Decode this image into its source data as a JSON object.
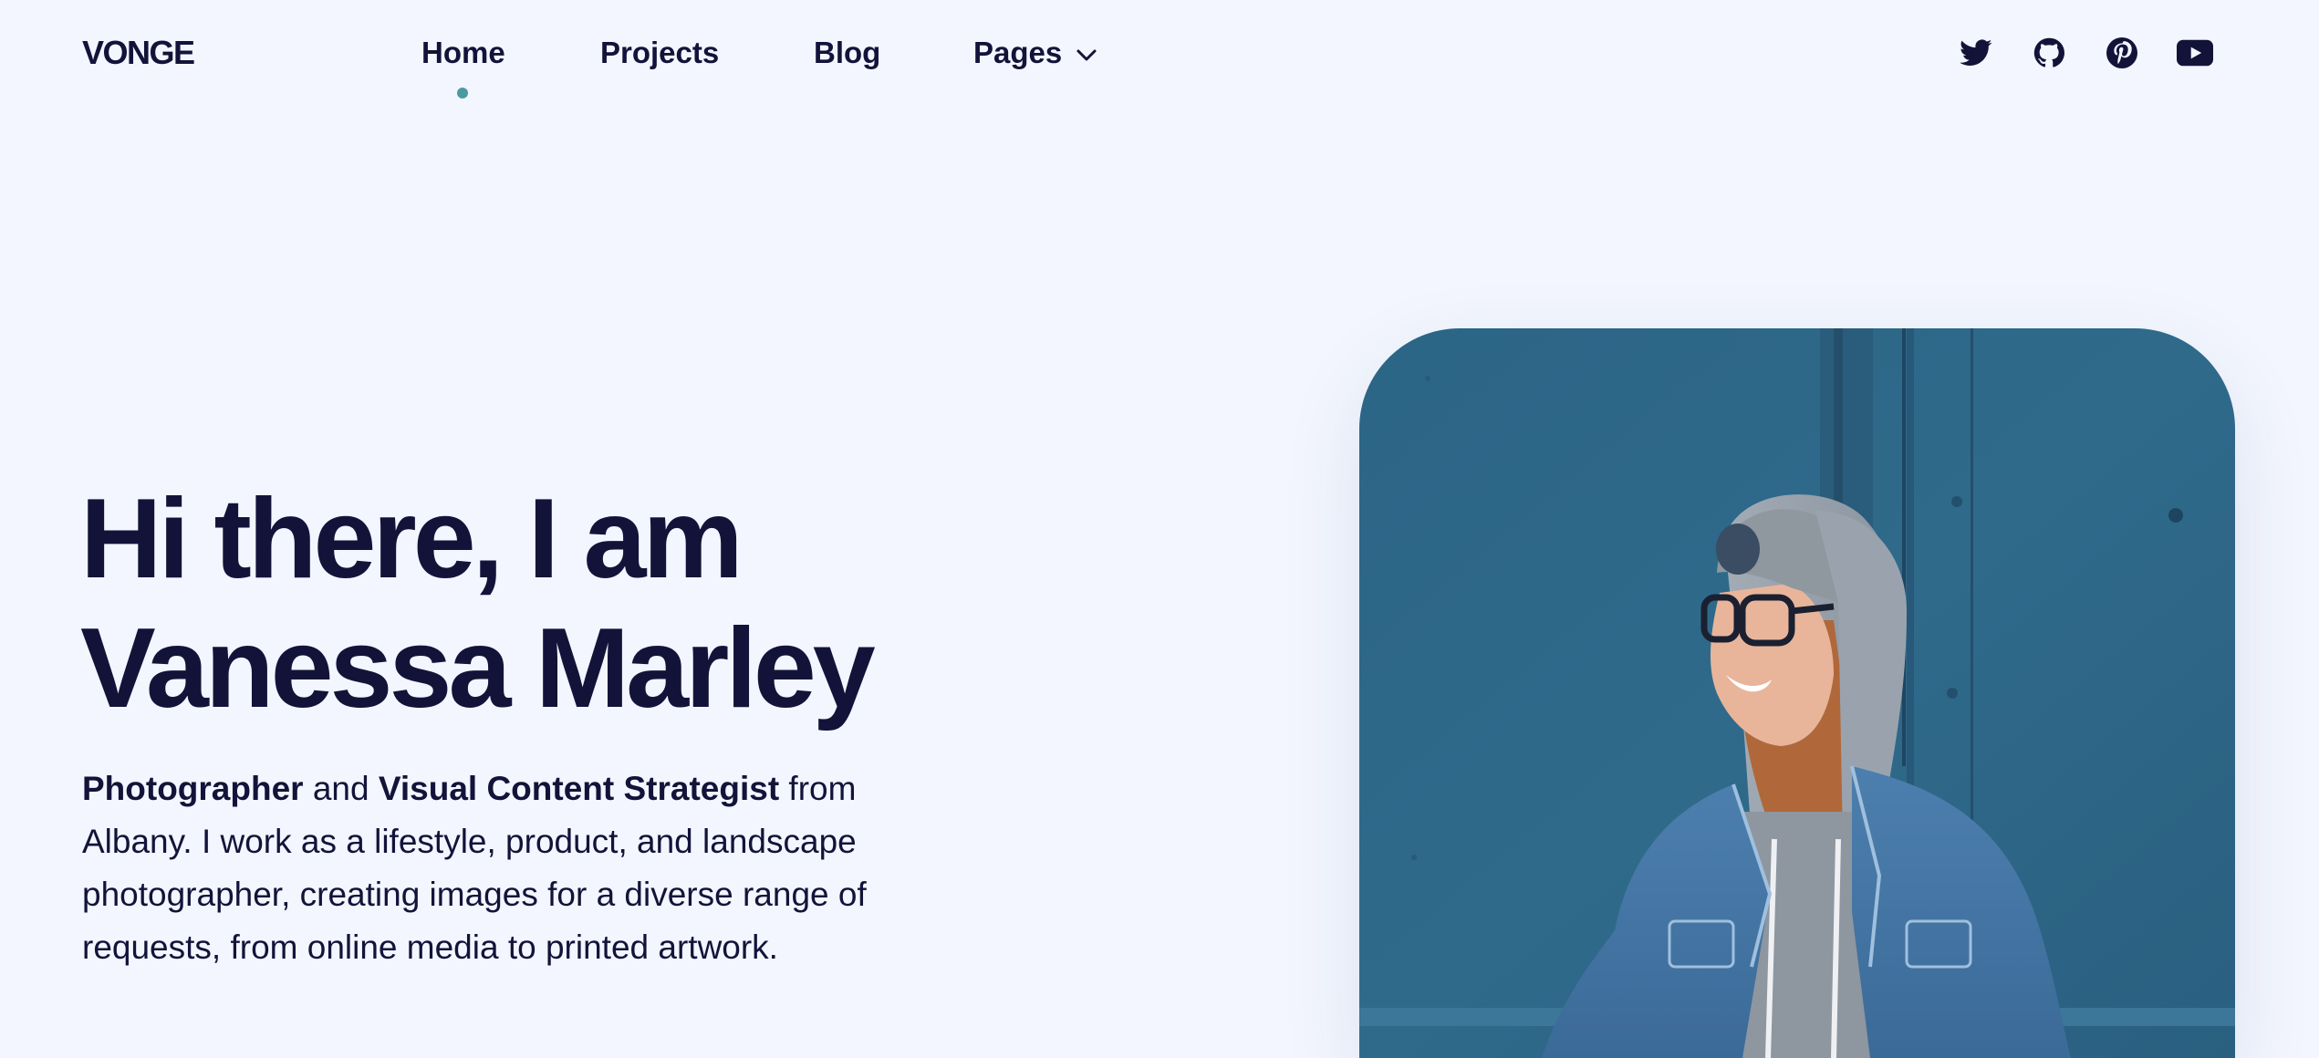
{
  "brand": {
    "logo": "VONGE"
  },
  "nav": {
    "items": [
      {
        "label": "Home",
        "active": true
      },
      {
        "label": "Projects",
        "active": false
      },
      {
        "label": "Blog",
        "active": false
      },
      {
        "label": "Pages",
        "active": false,
        "has_dropdown": true
      }
    ]
  },
  "socials": [
    {
      "name": "twitter-icon"
    },
    {
      "name": "github-icon"
    },
    {
      "name": "pinterest-icon"
    },
    {
      "name": "youtube-icon"
    }
  ],
  "hero": {
    "title_line1": "Hi there, I am",
    "title_line2": "Vanessa Marley",
    "desc_role1": "Photographer",
    "desc_and": " and ",
    "desc_role2": "Visual Content Strategist",
    "desc_rest": " from Albany. I work as a lifestyle, product, and landscape photographer, creating images for a diverse range of requests, from online media to printed artwork."
  },
  "colors": {
    "background": "#f3f6fe",
    "text": "#13133a",
    "accent": "#4a9aa0",
    "photo_wall": "#2f6788"
  }
}
